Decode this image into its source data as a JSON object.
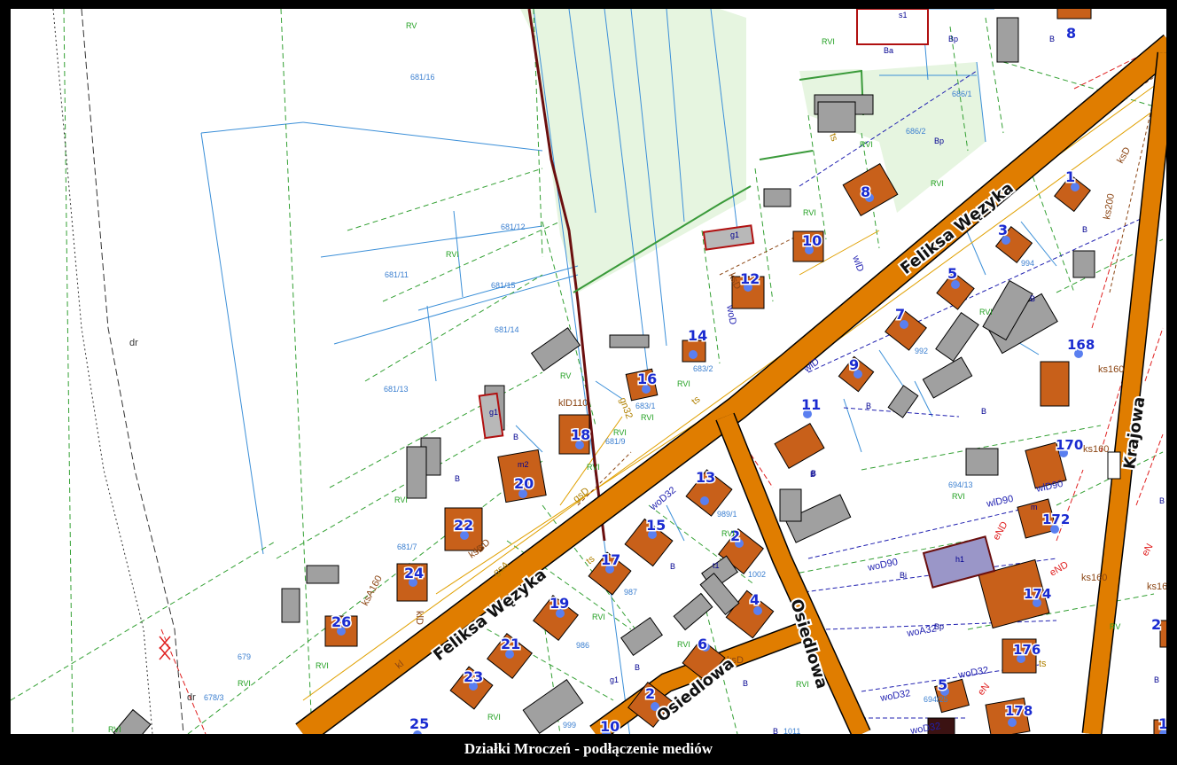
{
  "caption": "Działki Mroczeń - podłączenie mediów",
  "colors": {
    "road": "#e07d00",
    "building_new": "#c8601a",
    "building_existing": "#a0a0a0",
    "building_special": "#9a96c8",
    "parcel_line": "#3b8fd8",
    "landuse_line": "#2aa02a",
    "gas": "#e0a000",
    "water": "#1f1fb0",
    "sewer": "#8b4513",
    "electric": "#e02020",
    "meadow": "#e6f5e0"
  },
  "streets": [
    {
      "id": "feliksa-upper",
      "label": "Feliksa Węzyka"
    },
    {
      "id": "feliksa-lower",
      "label": "Feliksa Węzyka"
    },
    {
      "id": "osiedlowa",
      "label": "Osiedlowa"
    },
    {
      "id": "krajowa",
      "label": "Krajowa"
    },
    {
      "id": "osiedlowa-lower",
      "label": "Osiedlowa"
    }
  ],
  "plot_numbers": [
    "1",
    "2",
    "3",
    "4",
    "5",
    "6",
    "7",
    "8",
    "9",
    "10",
    "11",
    "12",
    "13",
    "14",
    "15",
    "16",
    "17",
    "18",
    "19",
    "20",
    "21",
    "22",
    "23",
    "24",
    "25",
    "26",
    "2",
    "8",
    "168",
    "170",
    "172",
    "174",
    "176",
    "178",
    "5",
    "10",
    "13",
    "2"
  ],
  "parcel_ids": [
    "681/16",
    "681/12",
    "681/11",
    "681/15",
    "681/14",
    "681/13",
    "681/7",
    "679",
    "678/3",
    "683/1",
    "683/2",
    "681/9",
    "686/1",
    "686/2",
    "994",
    "992",
    "989/1",
    "987",
    "986",
    "999",
    "1002",
    "694/13",
    "694/25",
    "1011"
  ],
  "landuse_labels": [
    "RV",
    "RVI",
    "RVI",
    "RVI",
    "RVI",
    "RVI",
    "RVI",
    "RV",
    "RVI",
    "RVI",
    "RVI",
    "RVI",
    "RVI",
    "RVI",
    "RVI",
    "RVI",
    "RVI",
    "RVI",
    "RVI",
    "RVI",
    "RV",
    "RVI",
    "RVI"
  ],
  "building_codes": [
    "B",
    "B",
    "B",
    "B",
    "B",
    "B",
    "B",
    "B",
    "B",
    "B",
    "B",
    "B",
    "Bp",
    "Bp",
    "Bi",
    "Ba",
    "Bp",
    "B",
    "B",
    "B"
  ],
  "utility_labels": [
    "ksD",
    "ksD",
    "ksD",
    "ksD",
    "woD",
    "wlD",
    "wlD",
    "ts",
    "ts",
    "ts",
    "ts",
    "gsA",
    "gsD",
    "ks160",
    "ks160",
    "ks160",
    "ks160",
    "wlD90",
    "wlD90",
    "woD90",
    "woA32",
    "woD32",
    "woD32",
    "woD32",
    "eND",
    "eND",
    "eN",
    "kl",
    "klD",
    "klD110",
    "ksA160",
    "ksD",
    "gn32",
    "dr",
    "dr",
    "woD32",
    "ks200",
    "eN"
  ],
  "building_tags": [
    "g1",
    "g1",
    "m2",
    "t1",
    "m",
    "h1",
    "g1",
    "s1"
  ]
}
